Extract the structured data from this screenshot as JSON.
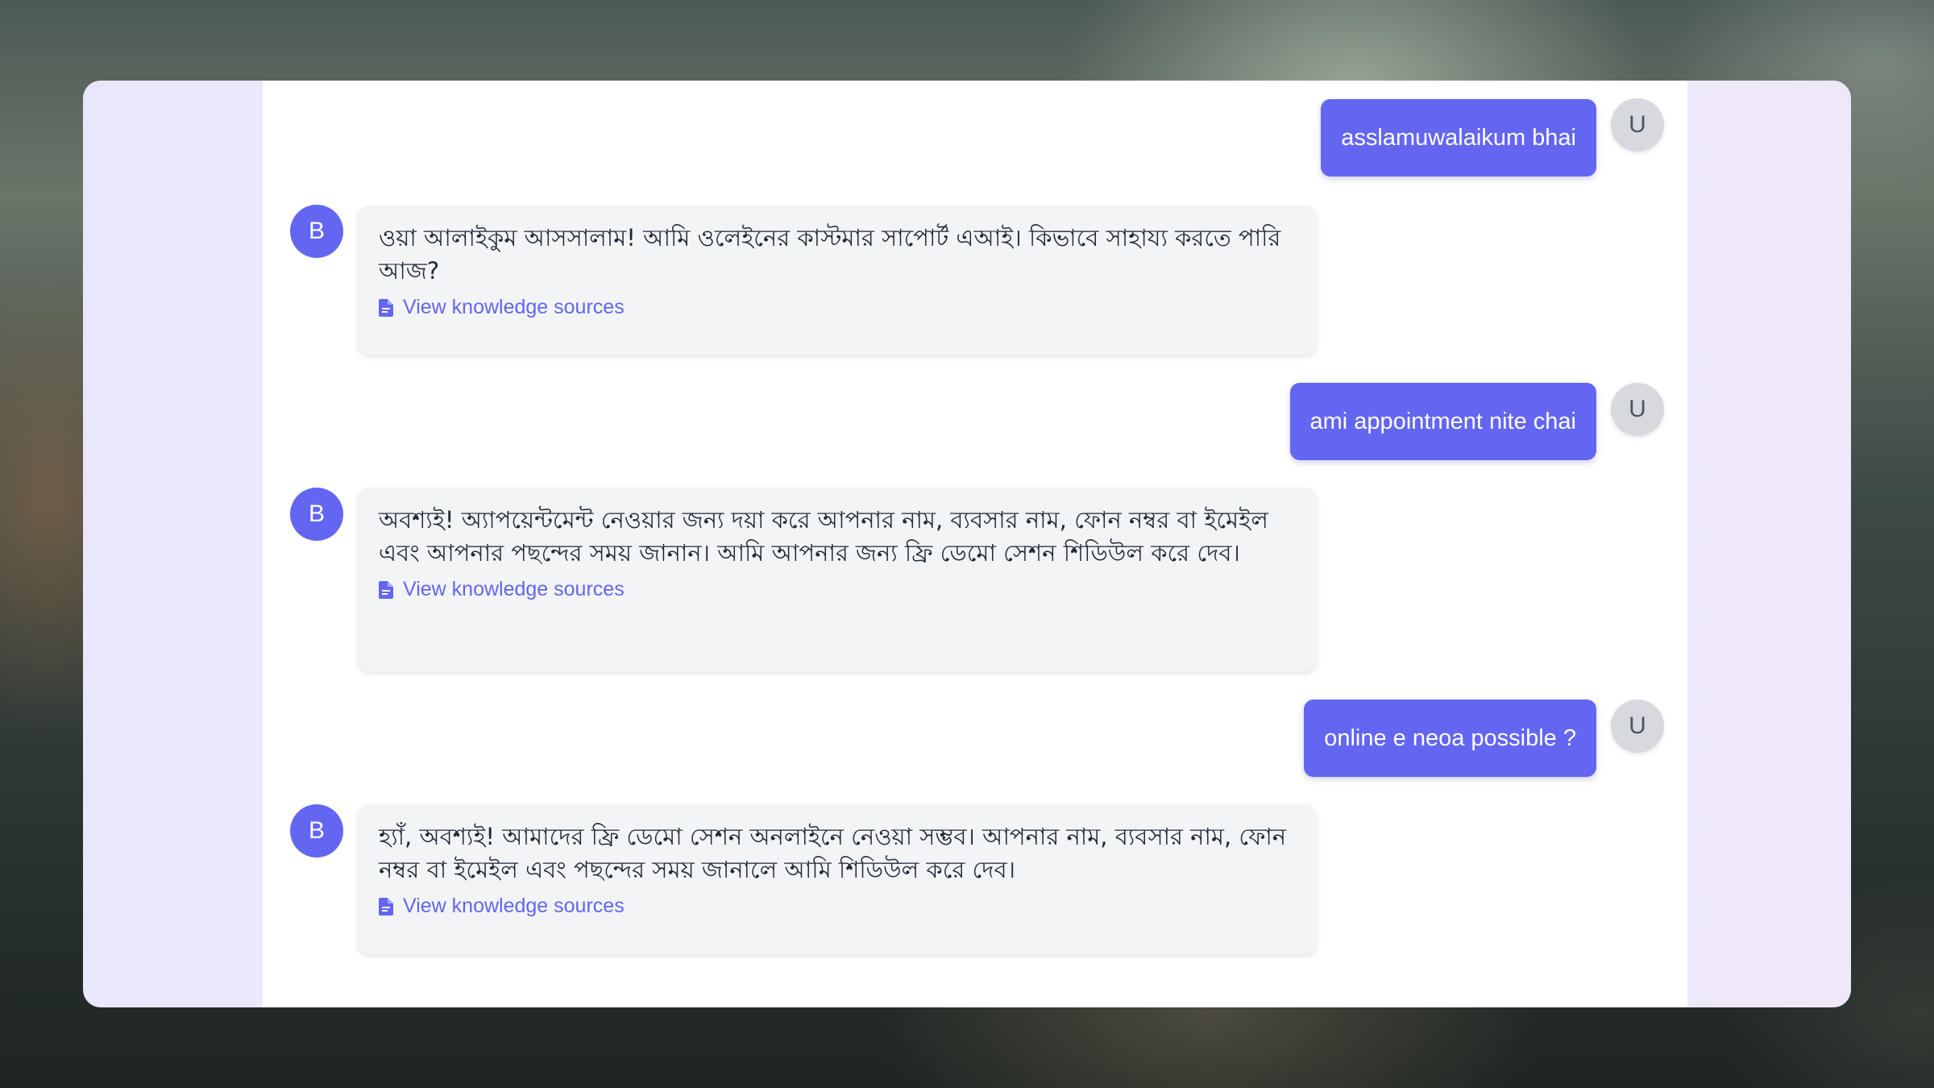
{
  "colors": {
    "accent": "#6366f1",
    "bot_bubble_bg": "#f3f4f6",
    "user_avatar_bg": "#d8d9de",
    "panel_bg": "#ebe9fb"
  },
  "icons": {
    "sources": "document-icon"
  },
  "conversation": [
    {
      "role": "user",
      "avatar": "U",
      "text": "asslamuwalaikum bhai"
    },
    {
      "role": "bot",
      "avatar": "B",
      "text": "ওয়া আলাইকুম আসসালাম! আমি ওলেইনের কাস্টমার সাপোর্ট এআই। কিভাবে সাহায্য করতে পারি আজ?",
      "sources_label": "View knowledge sources"
    },
    {
      "role": "user",
      "avatar": "U",
      "text": "ami appointment nite chai"
    },
    {
      "role": "bot",
      "avatar": "B",
      "text": "অবশ্যই! অ্যাপয়েন্টমেন্ট নেওয়ার জন্য দয়া করে আপনার নাম, ব্যবসার নাম, ফোন নম্বর বা ইমেইল এবং আপনার পছন্দের সময় জানান। আমি আপনার জন্য ফ্রি ডেমো সেশন শিডিউল করে দেব।",
      "sources_label": "View knowledge sources"
    },
    {
      "role": "user",
      "avatar": "U",
      "text": "online e neoa possible ?"
    },
    {
      "role": "bot",
      "avatar": "B",
      "text": "হ্যাঁ, অবশ্যই! আমাদের ফ্রি ডেমো সেশন অনলাইনে নেওয়া সম্ভব। আপনার নাম, ব্যবসার নাম, ফোন নম্বর বা ইমেইল এবং পছন্দের সময় জানালে আমি শিডিউল করে দেব।",
      "sources_label": "View knowledge sources"
    }
  ]
}
